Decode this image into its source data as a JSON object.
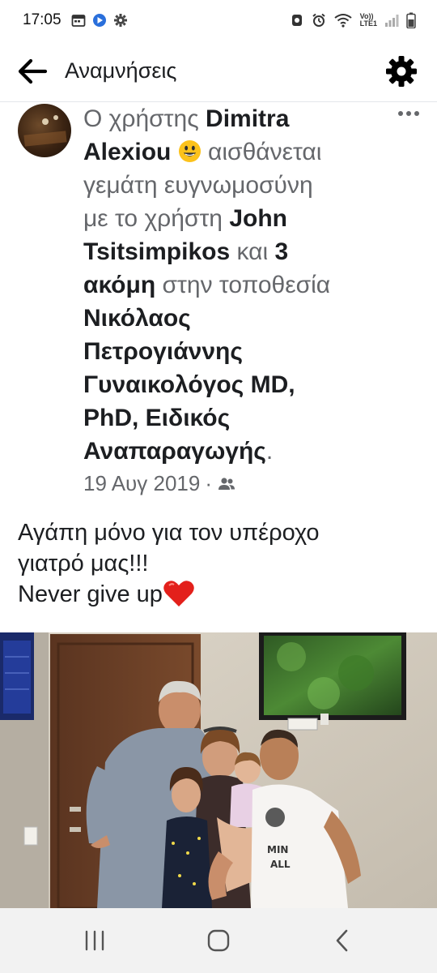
{
  "status_bar": {
    "time": "17:05",
    "left_icons": [
      "calendar-icon",
      "play-app-icon",
      "gear-icon"
    ],
    "right_icons": [
      "alarm-profile-icon",
      "alarm-clock-icon",
      "wifi-icon",
      "volte-lte-icon",
      "signal-icon",
      "battery-icon"
    ],
    "network_label_top": "Vo))",
    "network_label_bottom": "LTE1"
  },
  "header": {
    "title": "Αναμνήσεις",
    "back_icon": "arrow-left-icon",
    "settings_icon": "gear-icon"
  },
  "post": {
    "prefix": "Ο χρήστης",
    "author_first": "Dimitra",
    "author_last": "Alexiou",
    "feeling_emoji": "smiling-face-icon",
    "feeling_text": "αισθάνεται",
    "feeling_line2": "γεμάτη ευγνωμοσύνη",
    "with_text": "με το χρήστη",
    "tagged_first": "John",
    "tagged_last": "Tsitsimpikos",
    "and_text": "και",
    "others_count": "3",
    "others_label": "ακόμη",
    "at_text": "στην τοποθεσία",
    "place_line1": "Νικόλαος",
    "place_line2": "Πετρογιάννης",
    "place_line3": "Γυναικολόγος MD,",
    "place_line4": "PhD, Ειδικός",
    "place_line5": "Αναπαραγωγής",
    "period": ".",
    "date": "19 Αυγ 2019",
    "separator": "·",
    "audience_icon": "friends-icon",
    "body_line1": "Αγάπη μόνο για τον υπέροχο",
    "body_line2": "γιατρό μας!!!",
    "body_line3": "Never give up",
    "body_emoji": "red-heart-icon",
    "tshirt_text_1": "MIN",
    "tshirt_text_2": "ALL"
  },
  "nav": {
    "recents_icon": "recent-apps-icon",
    "home_icon": "home-icon",
    "back_icon": "back-chevron-icon"
  }
}
